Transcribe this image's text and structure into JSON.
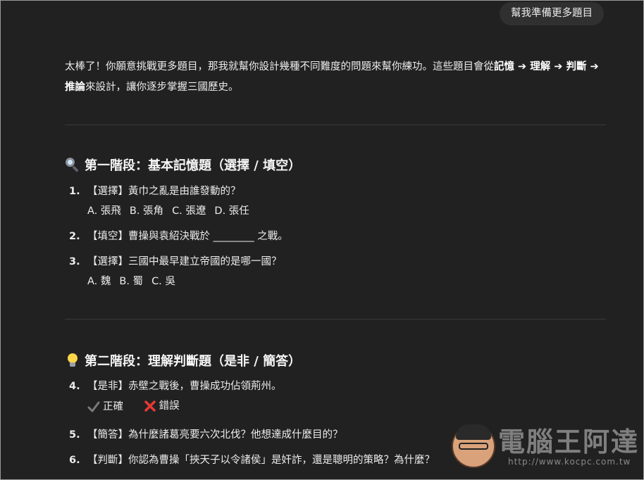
{
  "user_message": "幫我準備更多題目",
  "intro": {
    "part1": "太棒了！你願意挑戰更多題目，那我就幫你設計幾種不同難度的問題來幫你練功。這些題目會從",
    "bold1": "記憶 ➔ 理解 ➔ 判斷 ➔ 推論",
    "part2": "來設計，讓你逐步掌握三國歷史。"
  },
  "sections": [
    {
      "icon": "magnifier-icon",
      "title": "第一階段：基本記憶題（選擇 / 填空）",
      "questions": [
        {
          "num": "1.",
          "text": "【選擇】黃巾之亂是由誰發動的？",
          "options": [
            "A. 張飛",
            "B. 張角",
            "C. 張遼",
            "D. 張任"
          ]
        },
        {
          "num": "2.",
          "text": "【填空】曹操與袁紹決戰於 ________ 之戰。"
        },
        {
          "num": "3.",
          "text": "【選擇】三國中最早建立帝國的是哪一國？",
          "options": [
            "A. 魏",
            "B. 蜀",
            "C. 吳"
          ]
        }
      ]
    },
    {
      "icon": "lightbulb-icon",
      "title": "第二階段：理解判斷題（是非 / 簡答）",
      "questions": [
        {
          "num": "4.",
          "text": "【是非】赤壁之戰後，曹操成功佔領荊州。",
          "marks": [
            "正確",
            "錯誤"
          ]
        },
        {
          "num": "5.",
          "text": "【簡答】為什麼諸葛亮要六次北伐？他想達成什麼目的？"
        },
        {
          "num": "6.",
          "text": "【判斷】你認為曹操「挾天子以令諸侯」是奸詐，還是聰明的策略？為什麼？"
        }
      ]
    }
  ],
  "watermark": {
    "title": "電腦王阿達",
    "url": "http://www.kocpc.com.tw"
  }
}
